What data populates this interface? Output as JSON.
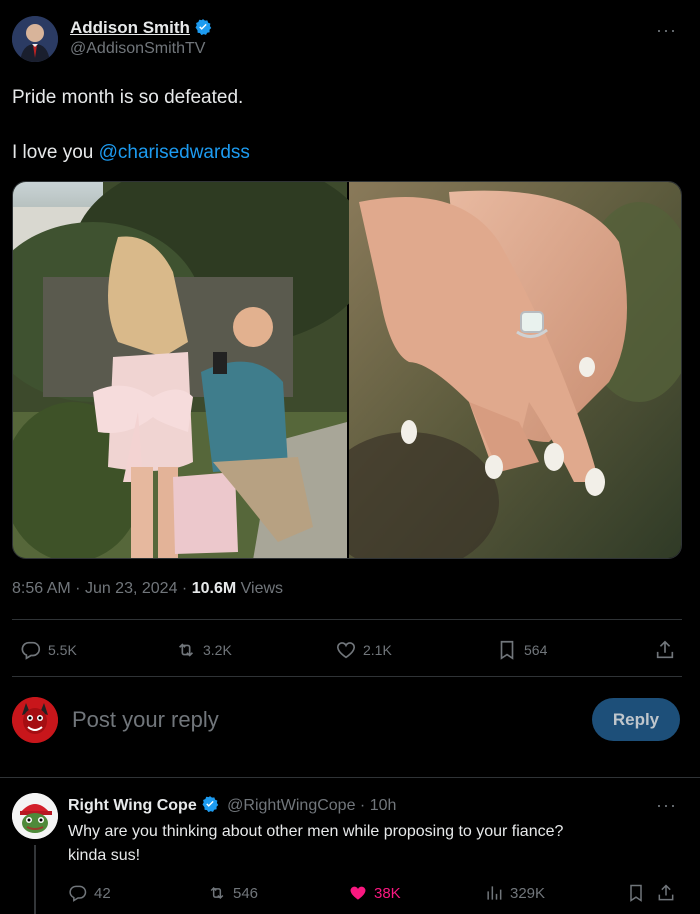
{
  "tweet": {
    "author_name": "Addison Smith",
    "author_handle": "@AddisonSmithTV",
    "more": "···",
    "text_line1": "Pride month is so defeated.",
    "text_line2_prefix": "I love you ",
    "text_mention": "@charisedwardss",
    "time": "8:56 AM",
    "sep1": "·",
    "date": "Jun 23, 2024",
    "sep2": "·",
    "views_count": "10.6M",
    "views_label": "Views",
    "stats": {
      "replies": "5.5K",
      "reposts": "3.2K",
      "likes": "2.1K",
      "bookmarks": "564"
    }
  },
  "compose": {
    "placeholder": "Post your reply",
    "reply_button": "Reply"
  },
  "comment": {
    "author_name": "Right Wing Cope",
    "author_handle": "@RightWingCope",
    "sep": "·",
    "time": "10h",
    "more": "···",
    "text_line1": "Why are you thinking about other men while proposing to your fiance?",
    "text_line2": "kinda sus!",
    "stats": {
      "replies": "42",
      "reposts": "546",
      "likes": "38K",
      "views": "329K"
    },
    "like_color": "#f91880"
  },
  "colors": {
    "accent": "#1d9bf0",
    "verified": "#1d9bf0",
    "muted": "#71767b",
    "divider": "#2f3336"
  }
}
